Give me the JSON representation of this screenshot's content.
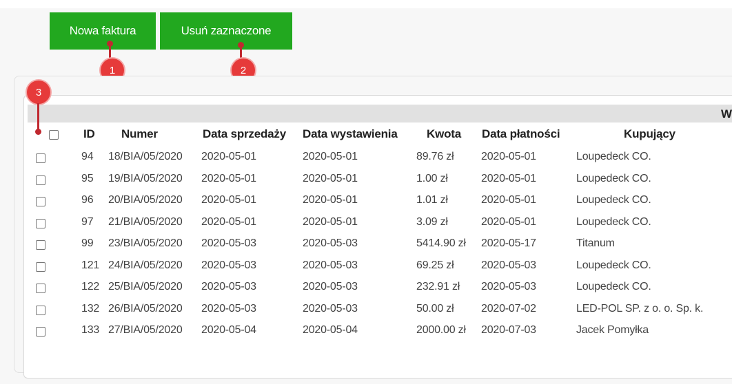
{
  "toolbar": {
    "new_invoice_label": "Nowa faktura",
    "delete_selected_label": "Usuń zaznaczone"
  },
  "markers": [
    "1",
    "2",
    "3"
  ],
  "table": {
    "group_header_partial": "W",
    "columns": [
      "ID",
      "Numer",
      "Data sprzedaży",
      "Data wystawienia",
      "Kwota",
      "Data płatności",
      "Kupujący"
    ],
    "rows": [
      {
        "id": "94",
        "numer": "18/BIA/05/2020",
        "sprzedaz": "2020-05-01",
        "wystawienie": "2020-05-01",
        "kwota": "89.76 zł",
        "platnosc": "2020-05-01",
        "kupujacy": "Loupedeck CO."
      },
      {
        "id": "95",
        "numer": "19/BIA/05/2020",
        "sprzedaz": "2020-05-01",
        "wystawienie": "2020-05-01",
        "kwota": "1.00 zł",
        "platnosc": "2020-05-01",
        "kupujacy": "Loupedeck CO."
      },
      {
        "id": "96",
        "numer": "20/BIA/05/2020",
        "sprzedaz": "2020-05-01",
        "wystawienie": "2020-05-01",
        "kwota": "1.01 zł",
        "platnosc": "2020-05-01",
        "kupujacy": "Loupedeck CO."
      },
      {
        "id": "97",
        "numer": "21/BIA/05/2020",
        "sprzedaz": "2020-05-01",
        "wystawienie": "2020-05-01",
        "kwota": "3.09 zł",
        "platnosc": "2020-05-01",
        "kupujacy": "Loupedeck CO."
      },
      {
        "id": "99",
        "numer": "23/BIA/05/2020",
        "sprzedaz": "2020-05-03",
        "wystawienie": "2020-05-03",
        "kwota": "5414.90 zł",
        "platnosc": "2020-05-17",
        "kupujacy": "Titanum"
      },
      {
        "id": "121",
        "numer": "24/BIA/05/2020",
        "sprzedaz": "2020-05-03",
        "wystawienie": "2020-05-03",
        "kwota": "69.25 zł",
        "platnosc": "2020-05-03",
        "kupujacy": "Loupedeck CO."
      },
      {
        "id": "122",
        "numer": "25/BIA/05/2020",
        "sprzedaz": "2020-05-03",
        "wystawienie": "2020-05-03",
        "kwota": "232.91 zł",
        "platnosc": "2020-05-03",
        "kupujacy": "Loupedeck CO."
      },
      {
        "id": "132",
        "numer": "26/BIA/05/2020",
        "sprzedaz": "2020-05-03",
        "wystawienie": "2020-05-03",
        "kwota": "50.00 zł",
        "platnosc": "2020-07-02",
        "kupujacy": "LED-POL SP. z o. o. Sp. k."
      },
      {
        "id": "133",
        "numer": "27/BIA/05/2020",
        "sprzedaz": "2020-05-04",
        "wystawienie": "2020-05-04",
        "kwota": "2000.00 zł",
        "platnosc": "2020-07-03",
        "kupujacy": "Jacek Pomyłka"
      }
    ]
  },
  "colors": {
    "button_green": "#22a81f",
    "marker_red": "#e63a3a",
    "header_band": "#e1e1e1"
  }
}
